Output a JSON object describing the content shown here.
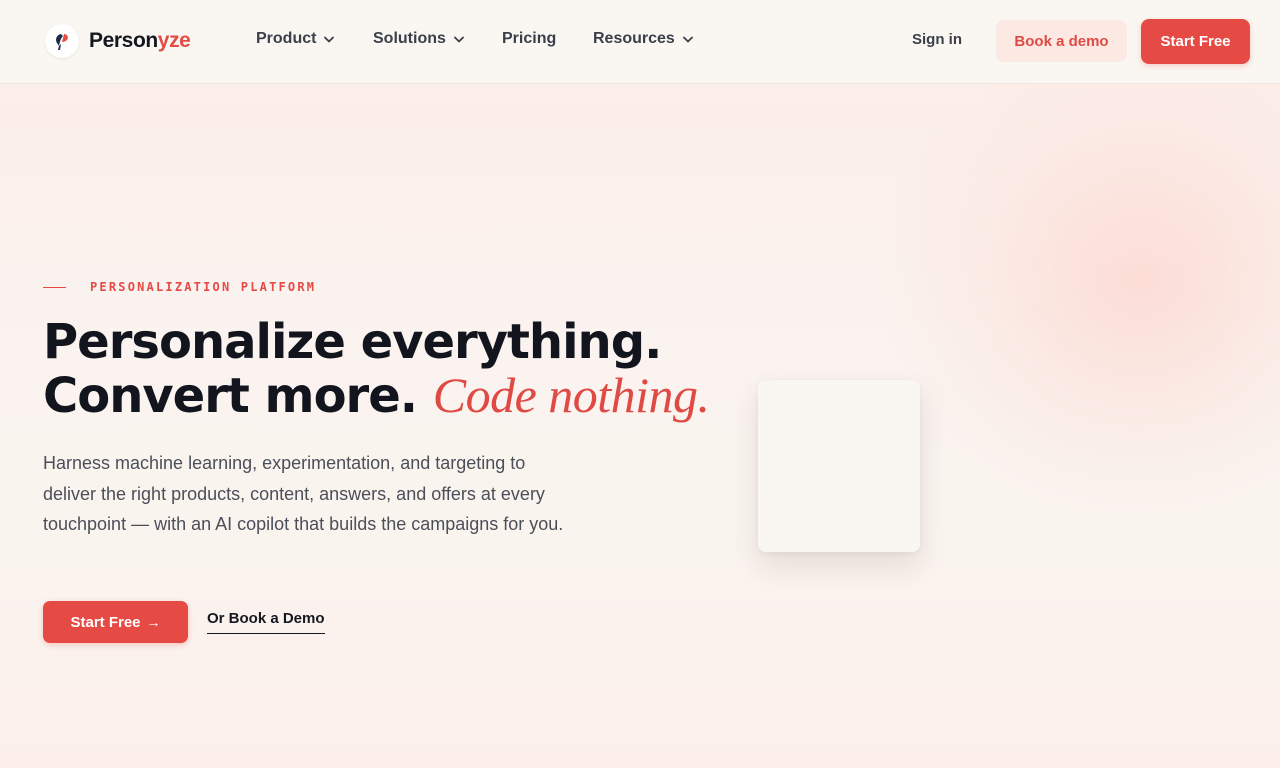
{
  "brand": {
    "name_part1": "Person",
    "name_part2": "yze",
    "accent_color": "#e64a45"
  },
  "nav": {
    "items": [
      {
        "label": "Product",
        "has_dropdown": true
      },
      {
        "label": "Solutions",
        "has_dropdown": true
      },
      {
        "label": "Pricing",
        "has_dropdown": false
      },
      {
        "label": "Resources",
        "has_dropdown": true
      }
    ],
    "sign_in": "Sign in",
    "book_demo": "Book a demo",
    "start_free": "Start Free"
  },
  "hero": {
    "eyebrow": "PERSONALIZATION PLATFORM",
    "headline_line1": "Personalize everything.",
    "headline_line2": "Convert more.",
    "headline_accent": "Code nothing.",
    "description": "Harness machine learning, experimentation, and targeting to deliver the right products, content, answers, and offers at every touchpoint — with an AI copilot that builds the campaigns for you.",
    "cta_primary": "Start Free",
    "cta_primary_icon": "arrow-right-icon",
    "cta_primary_arrow": "→",
    "cta_secondary": "Or Book a Demo"
  },
  "icons": {
    "logo": "personyze-logo-icon",
    "dropdown": "chevron-down-icon"
  }
}
